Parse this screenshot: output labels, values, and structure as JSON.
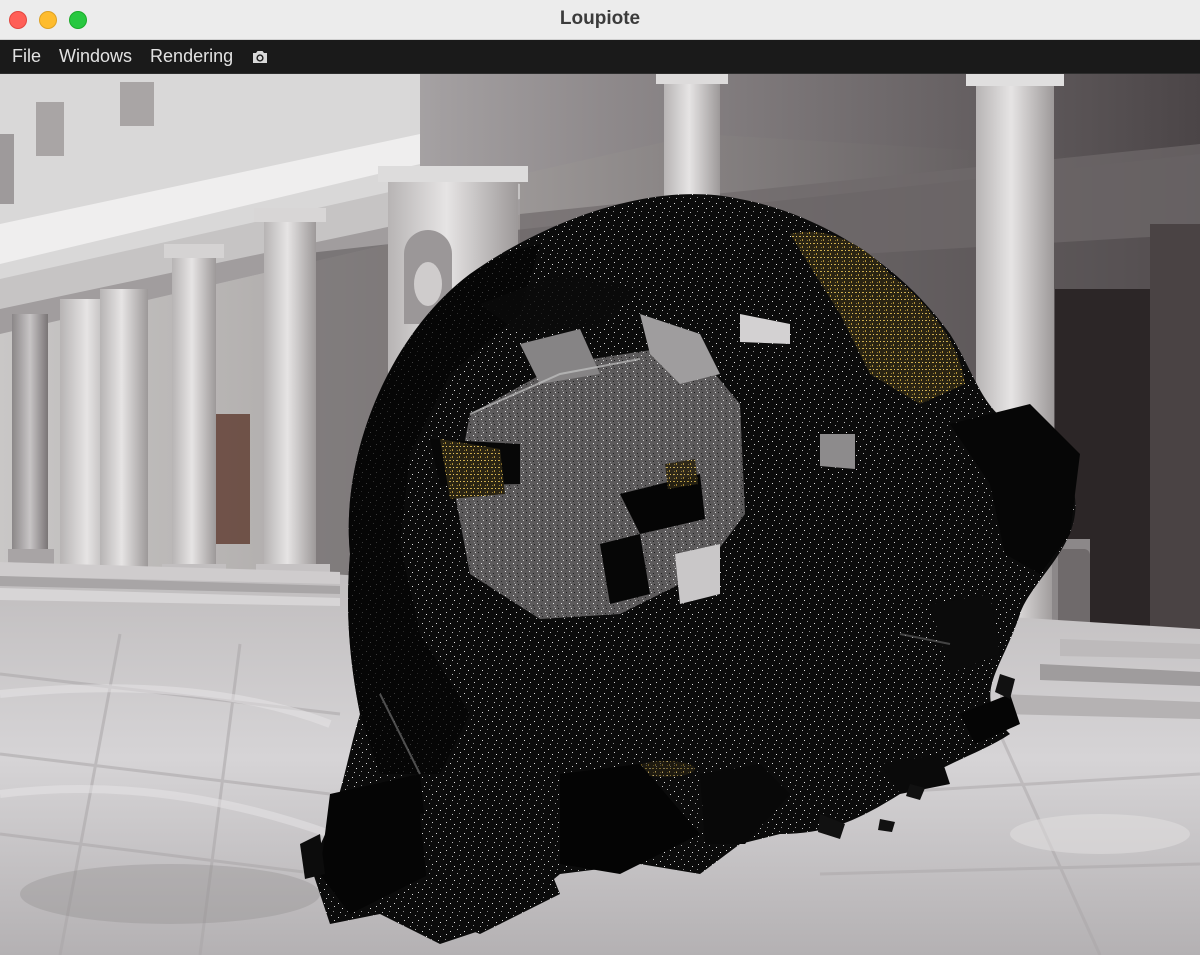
{
  "window": {
    "title": "Loupiote"
  },
  "menubar": {
    "items": [
      {
        "label": "File"
      },
      {
        "label": "Windows"
      },
      {
        "label": "Rendering"
      }
    ],
    "screenshot_icon": "camera-icon"
  },
  "viewport": {
    "background_scene": "colonnade-environment-map",
    "model": "point-sampled-mesh-head"
  },
  "colors": {
    "titlebar": "#ececec",
    "menubar": "#1a1a1a",
    "close": "#ff5f57",
    "minimize": "#febc2e",
    "maximize": "#28c840",
    "model_dark": "#050505",
    "model_gold": "#b79a3c"
  }
}
